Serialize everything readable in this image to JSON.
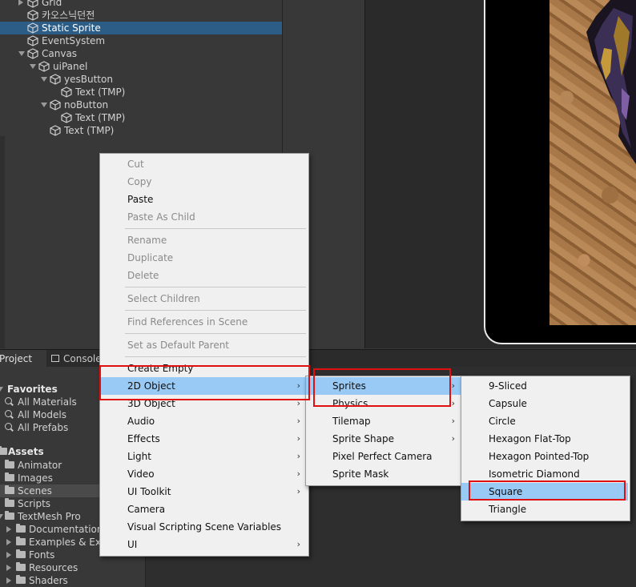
{
  "hierarchy": {
    "items": [
      {
        "label": "Grid",
        "indent": 1,
        "arrow": "right",
        "selected": false
      },
      {
        "label": "카오스닉던전",
        "indent": 1,
        "arrow": "",
        "selected": false
      },
      {
        "label": "Static Sprite",
        "indent": 1,
        "arrow": "",
        "selected": true
      },
      {
        "label": "EventSystem",
        "indent": 1,
        "arrow": "",
        "selected": false
      },
      {
        "label": "Canvas",
        "indent": 1,
        "arrow": "down",
        "selected": false
      },
      {
        "label": "uiPanel",
        "indent": 2,
        "arrow": "down",
        "selected": false
      },
      {
        "label": "yesButton",
        "indent": 3,
        "arrow": "down",
        "selected": false
      },
      {
        "label": "Text (TMP)",
        "indent": 4,
        "arrow": "",
        "selected": false
      },
      {
        "label": "noButton",
        "indent": 3,
        "arrow": "down",
        "selected": false
      },
      {
        "label": "Text (TMP)",
        "indent": 4,
        "arrow": "",
        "selected": false
      },
      {
        "label": "Text (TMP)",
        "indent": 3,
        "arrow": "",
        "selected": false
      }
    ]
  },
  "tabs": {
    "project": "Project",
    "console": "Console"
  },
  "project": {
    "rows": [
      {
        "label": "Favorites",
        "type": "header",
        "icon": "star",
        "x": 0
      },
      {
        "label": "All Materials",
        "type": "search",
        "x": 8
      },
      {
        "label": "All Models",
        "type": "search",
        "x": 8
      },
      {
        "label": "All Prefabs",
        "type": "search",
        "x": 8
      },
      {
        "label": "",
        "type": "gap",
        "x": 0
      },
      {
        "label": "Assets",
        "type": "header",
        "icon": "folder",
        "x": 0
      },
      {
        "label": "Animator",
        "type": "folder",
        "x": 8
      },
      {
        "label": "Images",
        "type": "folder",
        "x": 8
      },
      {
        "label": "Scenes",
        "type": "folder",
        "x": 8,
        "selected": true
      },
      {
        "label": "Scripts",
        "type": "folder",
        "x": 8
      },
      {
        "label": "TextMesh Pro",
        "type": "folder-open",
        "x": 8
      },
      {
        "label": "Documentation",
        "type": "folder",
        "x": 22
      },
      {
        "label": "Examples & Extras",
        "type": "folder",
        "x": 22
      },
      {
        "label": "Fonts",
        "type": "folder",
        "x": 22
      },
      {
        "label": "Resources",
        "type": "folder",
        "x": 22
      },
      {
        "label": "Shaders",
        "type": "folder",
        "x": 22
      }
    ]
  },
  "context_menu": {
    "items": [
      {
        "label": "Cut",
        "enabled": false
      },
      {
        "label": "Copy",
        "enabled": false
      },
      {
        "label": "Paste",
        "enabled": true
      },
      {
        "label": "Paste As Child",
        "enabled": false
      },
      {
        "sep": true
      },
      {
        "label": "Rename",
        "enabled": false
      },
      {
        "label": "Duplicate",
        "enabled": false
      },
      {
        "label": "Delete",
        "enabled": false
      },
      {
        "sep": true
      },
      {
        "label": "Select Children",
        "enabled": false
      },
      {
        "sep": true
      },
      {
        "label": "Find References in Scene",
        "enabled": false
      },
      {
        "sep": true
      },
      {
        "label": "Set as Default Parent",
        "enabled": false
      },
      {
        "sep": true
      },
      {
        "label": "Create Empty",
        "enabled": true
      },
      {
        "label": "2D Object",
        "enabled": true,
        "submenu": true,
        "highlighted": true
      },
      {
        "label": "3D Object",
        "enabled": true,
        "submenu": true
      },
      {
        "label": "Audio",
        "enabled": true,
        "submenu": true
      },
      {
        "label": "Effects",
        "enabled": true,
        "submenu": true
      },
      {
        "label": "Light",
        "enabled": true,
        "submenu": true
      },
      {
        "label": "Video",
        "enabled": true,
        "submenu": true
      },
      {
        "label": "UI Toolkit",
        "enabled": true,
        "submenu": true
      },
      {
        "label": "Camera",
        "enabled": true
      },
      {
        "label": "Visual Scripting Scene Variables",
        "enabled": true
      },
      {
        "label": "UI",
        "enabled": true,
        "submenu": true
      }
    ]
  },
  "submenu_2d": {
    "items": [
      {
        "label": "Sprites",
        "submenu": true,
        "highlighted": true
      },
      {
        "label": "Physics",
        "submenu": true
      },
      {
        "label": "Tilemap",
        "submenu": true
      },
      {
        "label": "Sprite Shape",
        "submenu": true
      },
      {
        "label": "Pixel Perfect Camera",
        "submenu": false
      },
      {
        "label": "Sprite Mask",
        "submenu": false
      }
    ]
  },
  "submenu_sprites": {
    "items": [
      {
        "label": "9-Sliced"
      },
      {
        "label": "Capsule"
      },
      {
        "label": "Circle"
      },
      {
        "label": "Hexagon Flat-Top"
      },
      {
        "label": "Hexagon Pointed-Top"
      },
      {
        "label": "Isometric Diamond"
      },
      {
        "label": "Square",
        "highlighted": true
      },
      {
        "label": "Triangle"
      }
    ]
  },
  "colors": {
    "selection": "#2c5d87",
    "menu_highlight": "#99c9f5",
    "annotation": "#e01010"
  }
}
